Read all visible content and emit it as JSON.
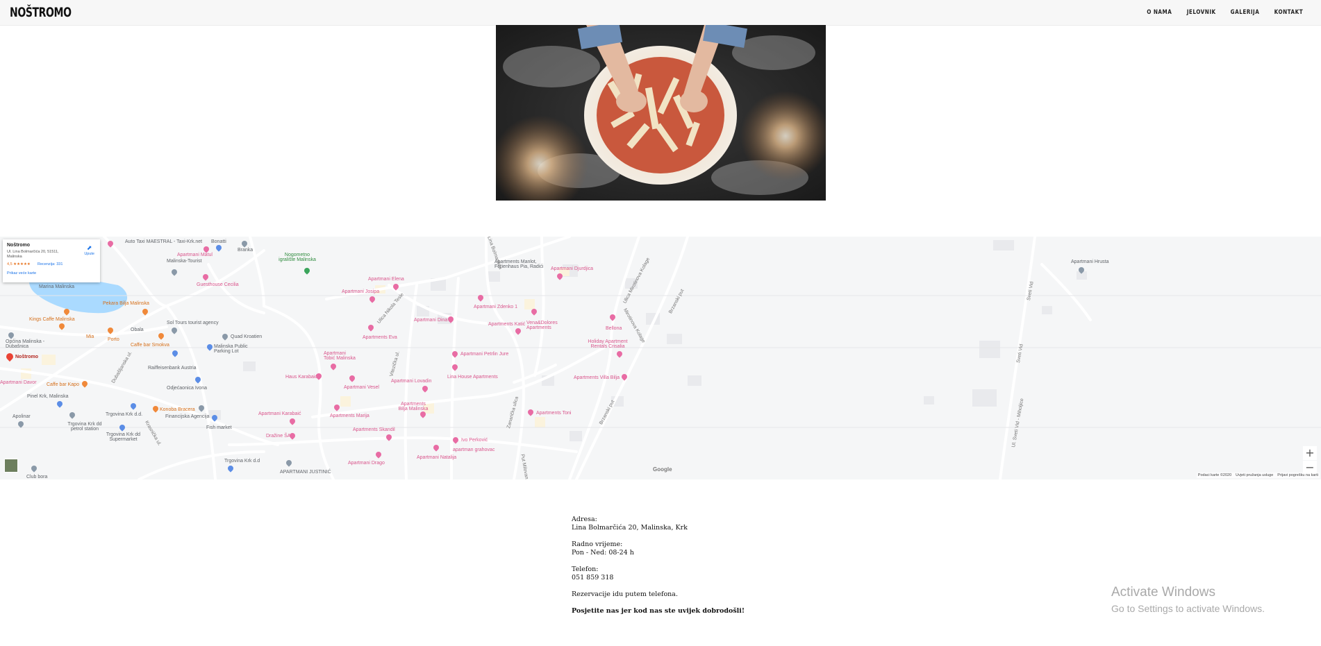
{
  "header": {
    "logo": "NOŠTROMO",
    "nav": [
      "O NAMA",
      "JELOVNIK",
      "GALERIJA",
      "KONTAKT"
    ]
  },
  "hero": {
    "alt": "Hands arranging toppings on a pizza dough"
  },
  "map": {
    "card": {
      "name": "Noštromo",
      "address": "Ul. Lina Bolmarčića 20, 51511, Malinska",
      "rating": "4,5 ★★★★★",
      "reviews": "Recenzija: 331",
      "larger_map": "Prikaz veće karte",
      "directions": "Upute"
    },
    "labels": {
      "auto_taxi": "Auto Taxi MAESTRAL - Taxi-Krk.net",
      "bonatti": "Bonatti",
      "branka": "Branka",
      "nogometno": "Nogometno igralište Malinska",
      "apt_matul": "Apartmani Matul",
      "malinska_tourist": "Malinska-Tourist",
      "guesthouse_cecilia": "Guesthouse Cecilia",
      "apt_elena": "Apartmani Elena",
      "apt_josipa": "Apartmani Josipa",
      "apt_manlot": "Apartments Manlot, Ferienhaus Pia, Radići",
      "apt_djurdjica": "Apartmani Djurdjica",
      "marina": "Marina Malinska",
      "pekara": "Pekara Bilja Malinska",
      "kings": "Kings Caffe Malinska",
      "sol_tours": "Sol Tours tourist agency",
      "quad": "Quad Kroatien",
      "mia": "Mia",
      "porto": "Porto",
      "obala": "Obala",
      "caffe_smokvica": "Caffe bar Smokva",
      "malinska_parking": "Malinska Public Parking Lot",
      "opcina": "Općina Malinska - Dubašnica",
      "apt_dina": "Apartmani Dina",
      "apt_zdenko": "Apartmani Zdenko 1",
      "apt_katic": "Apartments Katić",
      "vena_dolores": "Vena&Dolores Apartments",
      "bellona": "Bellona",
      "apt_eva": "Apartments Eva",
      "holiday_apt": "Holiday Apartment Rentals Crisalia",
      "apt_petrlin": "Apartmani Petrlin Jure",
      "nostromo_pin": "Noštromo",
      "raiffeisen": "Raiffeisenbank Austria",
      "apt_tobic": "Apartmani Tobić Malinska",
      "haus_karabaic": "Haus Karabaić",
      "lina_house": "Lina House Apartments",
      "apt_villa_bilja": "Apartments Villa Bilja",
      "apt_davor": "Apartmani Davor",
      "caffe_kapo": "Caffe bar Kapo",
      "odjecaonica": "Odjećaonica Ivona",
      "apt_vesel": "Apartmani Vesel",
      "apt_lovadin": "Apartmani Lovadin",
      "pinel": "Pinel Krk, Malinska",
      "trgovina_krk": "Trgovina Krk d.d.",
      "konoba_bracera": "Konoba Bracera",
      "financijska": "Financijska Agencija",
      "apt_bilja_malinska": "Apartments Bilja Malinska",
      "apt_toni": "Apartments Toni",
      "apolinar": "Apolinar",
      "trgovina_petrol": "Trgovina Krk dd petrol station",
      "apt_karabaic": "Apartmani Karabaić",
      "apt_marija": "Apartments Marija",
      "trgovina_supermarket": "Trgovina Krk dd Supermarket",
      "fish_market": "Fish market",
      "apt_skandil": "Apartments Skandil",
      "drazine": "Dražine ŠA",
      "ivo_perkovic": "Ivo Perković",
      "apt_grahovac": "apartman grahovac",
      "apt_natalia": "Apartmani Natalija",
      "apt_drago": "Apartmani Drago",
      "trgovina_krk_2": "Trgovina Krk d.d",
      "apt_justinic": "APARTMANI JUSTINIĆ",
      "club_bora": "Club bora",
      "apt_hrusta": "Apartmani Hrusta",
      "sveti_vid": "Sveti Vid",
      "ul_sveti_vid": "Ul. Sveti Vid - Miholjice",
      "brzanski_put": "Brzanski put",
      "dubasljanska": "Dubašljanska ul.",
      "krasnicka": "Krasnička ul.",
      "ul_zvezde": "Ulica Mirotinova Kolage",
      "mirotinova": "Mirotinova Kolage",
      "dalmatinska": "Ulica Nikola Tesle",
      "vitezica": "Vitezička ul.",
      "put_milovana": "Put Milovana",
      "zanarica": "Zanarička ulica",
      "lina_bolm": "Ul. Lina Bolmarčića",
      "ul_bora": "ul.",
      "ul_label": "Sveti Vid"
    },
    "google": "Google",
    "attribution": [
      "Podaci karte ©2020",
      "Uvjeti pružanja usluge",
      "Prijavi pogrešku na karti"
    ]
  },
  "contact": {
    "address_label": "Adresa:",
    "address": "Lina Bolmarčića 20, Malinska, Krk",
    "hours_label": "Radno vrijeme:",
    "hours": "Pon - Ned: 08-24 h",
    "phone_label": "Telefon:",
    "phone": "051 859 318",
    "reservation": "Rezervacije idu putem telefona.",
    "welcome": "Posjetite nas jer kod nas ste uvijek dobrodošli!"
  },
  "overlay": {
    "activate_title": "Activate Windows",
    "activate_sub": "Go to Settings to activate Windows."
  },
  "colors": {
    "pink_poi": "#d9548b",
    "water": "#aadaff",
    "marker": "#ea4335"
  }
}
